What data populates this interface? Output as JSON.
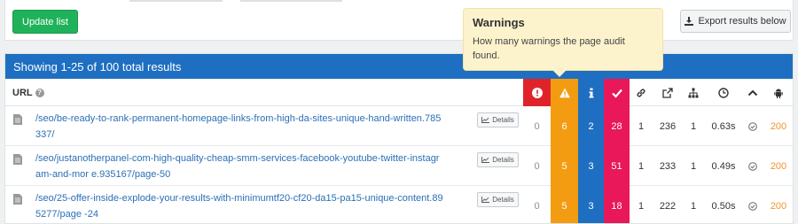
{
  "toolbar": {
    "update_label": "Update list",
    "export_label": "Export results below"
  },
  "results": {
    "summary": "Showing 1-25 of 100 total results"
  },
  "table": {
    "url_header": "URL",
    "details_label": "Details",
    "header_icons": [
      "error-icon",
      "warning-icon",
      "info-icon",
      "passed-check-icon",
      "link-icon",
      "external-link-icon",
      "sitemap-icon",
      "clock-icon",
      "chevron-up-icon",
      "android-icon"
    ],
    "colors": {
      "error": "#e0232a",
      "warning": "#f39c12",
      "info": "#1e6fc1",
      "passed": "#e8185a",
      "status": "#f0962a"
    },
    "rows": [
      {
        "url": "/seo/be-ready-to-rank-permanent-homepage-links-from-high-da-sites-unique-hand-written.785337/",
        "errors": "0",
        "warnings": "6",
        "info": "2",
        "passed": "28",
        "links": "1",
        "external": "236",
        "depth": "1",
        "time": "0.63s",
        "status": "200"
      },
      {
        "url": "/seo/justanotherpanel-com-high-quality-cheap-smm-services-facebook-youtube-twitter-instagram-and-mor e.935167/page-50",
        "errors": "0",
        "warnings": "5",
        "info": "3",
        "passed": "51",
        "links": "1",
        "external": "233",
        "depth": "1",
        "time": "0.49s",
        "status": "200"
      },
      {
        "url": "/seo/25-offer-inside-explode-your-results-with-minimumtf20-cf20-da15-pa15-unique-content.895277/page -24",
        "errors": "0",
        "warnings": "5",
        "info": "3",
        "passed": "18",
        "links": "1",
        "external": "222",
        "depth": "1",
        "time": "0.50s",
        "status": "200"
      }
    ]
  },
  "tooltip": {
    "title": "Warnings",
    "body": "How many warnings the page audit found."
  }
}
